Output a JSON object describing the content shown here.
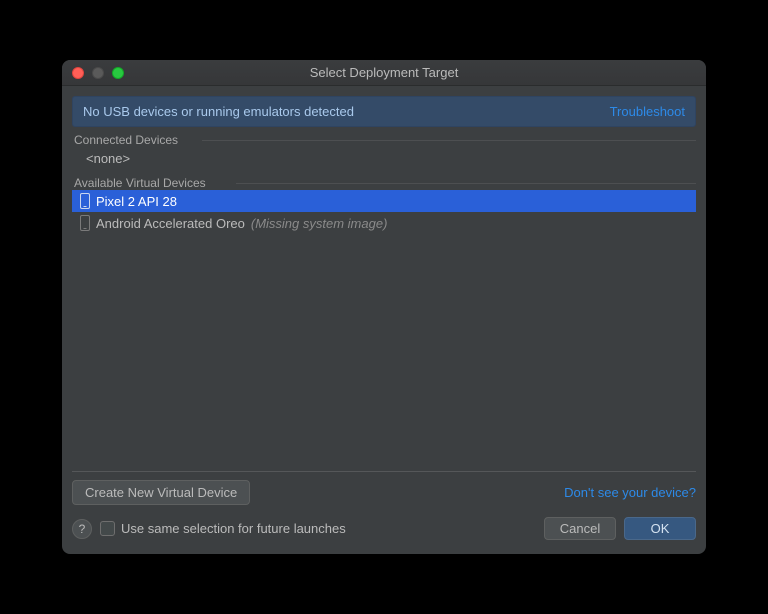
{
  "window": {
    "title": "Select Deployment Target"
  },
  "banner": {
    "message": "No USB devices or running emulators detected",
    "link": "Troubleshoot"
  },
  "sections": {
    "connected": {
      "label": "Connected Devices",
      "none_text": "<none>"
    },
    "available": {
      "label": "Available Virtual Devices",
      "devices": [
        {
          "name": "Pixel 2 API 28",
          "note": "",
          "selected": true
        },
        {
          "name": "Android Accelerated Oreo",
          "note": "(Missing system image)",
          "selected": false
        }
      ]
    }
  },
  "actions": {
    "create_button": "Create New Virtual Device",
    "dont_see_link": "Don't see your device?",
    "help_symbol": "?",
    "checkbox_label": "Use same selection for future launches",
    "cancel": "Cancel",
    "ok": "OK"
  }
}
